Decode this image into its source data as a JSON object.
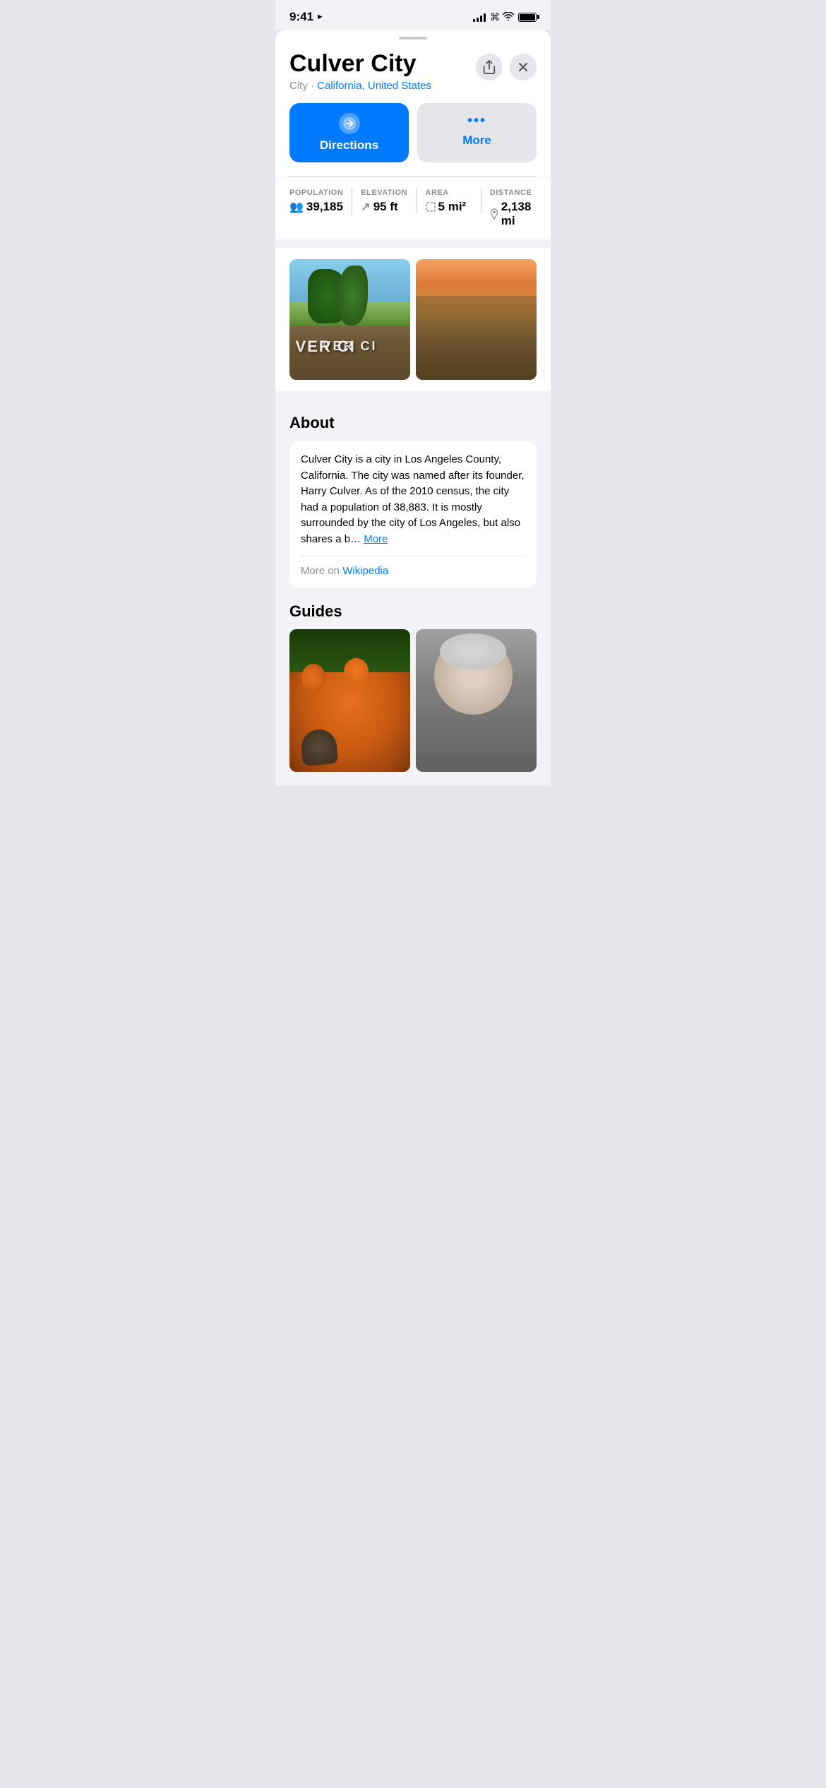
{
  "statusBar": {
    "time": "9:41",
    "locationArrow": "▲"
  },
  "header": {
    "title": "Culver City",
    "subtitle": "City · ",
    "locationLink": "California, United States",
    "shareLabel": "↑",
    "closeLabel": "✕"
  },
  "actions": {
    "directionsLabel": "Directions",
    "directionsIcon": "↗",
    "moreDotsIcon": "•••",
    "moreLabel": "More"
  },
  "stats": {
    "population": {
      "label": "POPULATION",
      "icon": "👥",
      "value": "39,185"
    },
    "elevation": {
      "label": "ELEVATION",
      "icon": "↗",
      "value": "95 ft"
    },
    "area": {
      "label": "AREA",
      "icon": "⬜",
      "value": "5 mi²"
    },
    "distance": {
      "label": "DISTANCE",
      "icon": "📍",
      "value": "2,138 mi"
    }
  },
  "about": {
    "sectionTitle": "About",
    "bodyText": "Culver City is a city in Los Angeles County, California. The city was named after its founder, Harry Culver. As of the 2010 census, the city had a population of 38,883. It is mostly surrounded by the city of Los Angeles, but also shares a b…",
    "moreLabel": "More",
    "wikipediaPrefix": "More on ",
    "wikipediaLink": "Wikipedia"
  },
  "guides": {
    "sectionTitle": "Guides"
  }
}
